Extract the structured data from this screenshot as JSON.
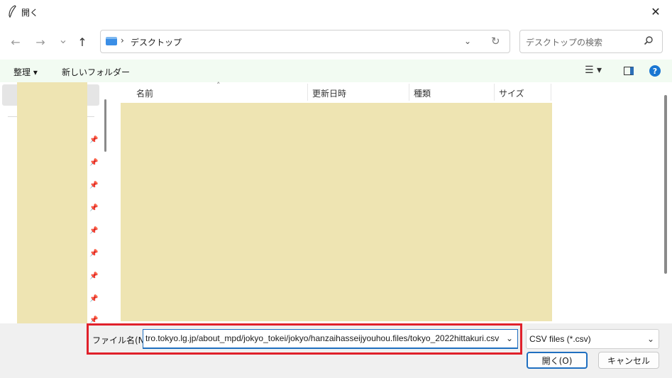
{
  "window": {
    "title": "開く"
  },
  "navigation": {
    "back_icon": "←",
    "forward_icon": "→",
    "recent_icon": "⌄",
    "up_icon": "↑"
  },
  "address_bar": {
    "separator": "›",
    "location": "デスクトップ"
  },
  "search": {
    "placeholder": "デスクトップの検索"
  },
  "toolbar": {
    "organize_label": "整理 ▾",
    "new_folder_label": "新しいフォルダー"
  },
  "file_list": {
    "columns": [
      "名前",
      "更新日時",
      "種類",
      "サイズ"
    ]
  },
  "bottom": {
    "filename_label": "ファイル名(N):",
    "filename_value": "tro.tokyo.lg.jp/about_mpd/jokyo_tokei/jokyo/hanzaihasseijyouhou.files/tokyo_2022hittakuri.csv",
    "filetype_value": "CSV files (*.csv)",
    "open_label": "開く(O)",
    "cancel_label": "キャンセル"
  },
  "colors": {
    "accent": "#1f6fc0",
    "highlight_border": "#e0212b",
    "redaction_fill": "#eee4b2",
    "toolbar_bg": "#f2fbf2"
  }
}
